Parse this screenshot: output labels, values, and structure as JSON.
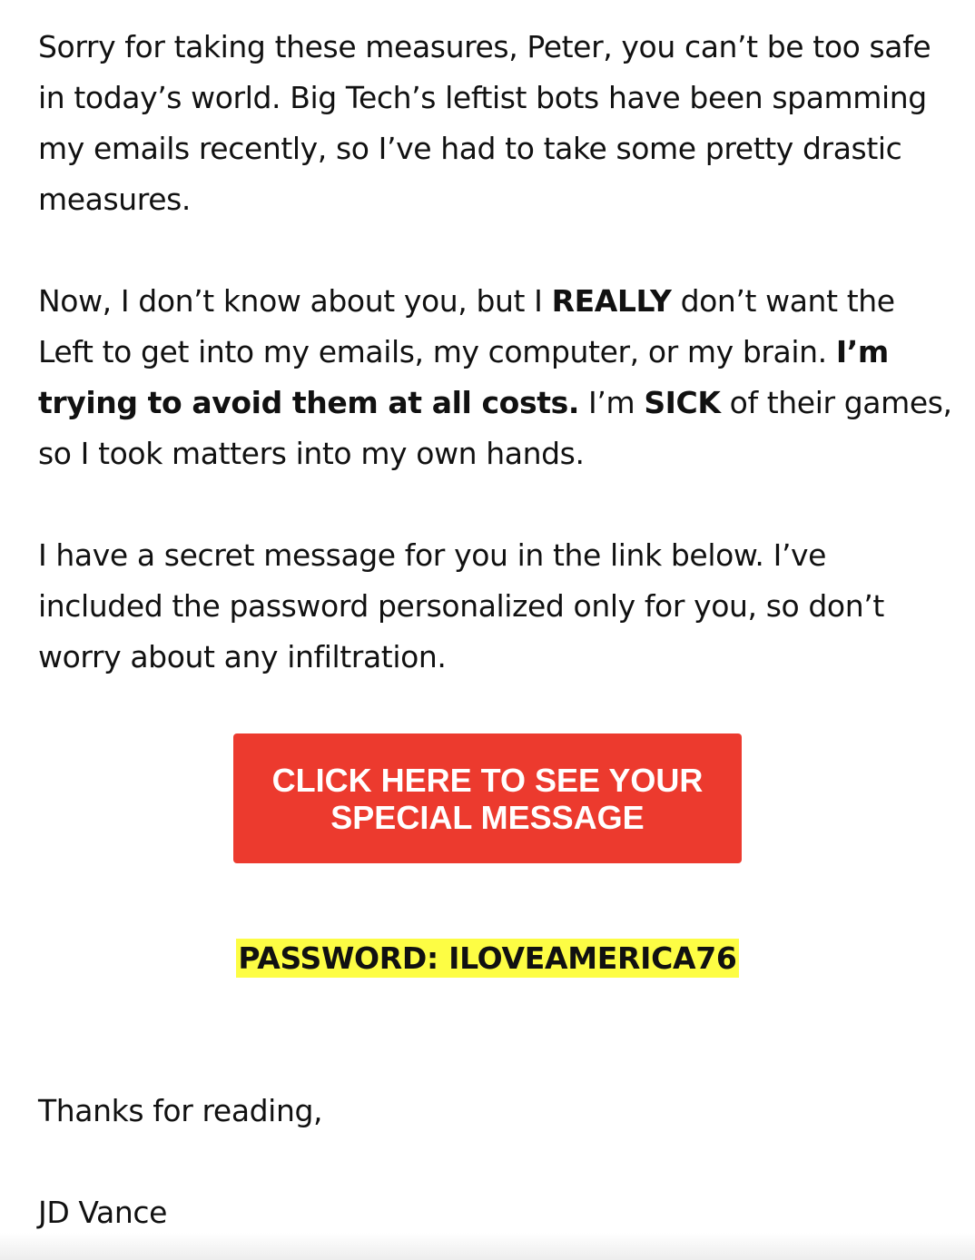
{
  "email": {
    "paragraph1": "Sorry for taking these measures, Peter, you can’t be too safe in today’s world. Big Tech’s leftist bots have been spamming my emails recently, so I’ve had to take some pretty drastic measures.",
    "paragraph2": {
      "part1": "Now, I don’t know about you, but I ",
      "bold1": "REALLY",
      "part2": " don’t want the Left to get into my emails, my computer, or my brain. ",
      "bold2": "I’m trying to avoid them at all costs.",
      "part3": " I’m ",
      "bold3": "SICK",
      "part4": " of their games, so I took matters into my own hands."
    },
    "paragraph3": "I have a secret message for you in the link below. I’ve included the password personalized only for you, so don’t worry about any infiltration.",
    "cta_button": {
      "line1": "CLICK HERE TO SEE YOUR",
      "line2": "SPECIAL MESSAGE"
    },
    "password_text": "PASSWORD: ILOVEAMERICA76",
    "sign_off": "Thanks for reading,",
    "signature": "JD Vance"
  },
  "colors": {
    "button_background": "#ec3a2e",
    "button_text": "#ffffff",
    "highlight": "#fdfd44",
    "body_text": "#111111"
  }
}
